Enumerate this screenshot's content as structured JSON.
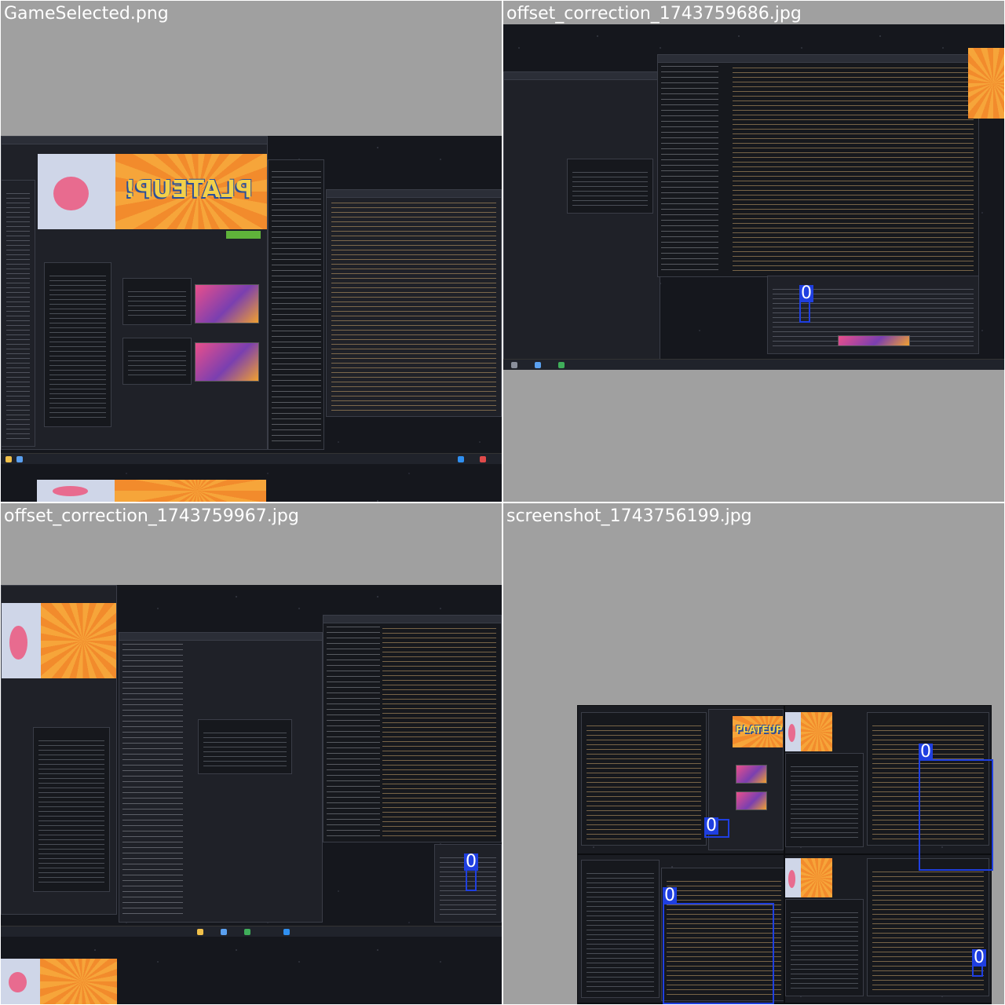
{
  "tiles": [
    {
      "caption": "GameSelected.png",
      "detections": []
    },
    {
      "caption": "offset_correction_1743759686.jpg",
      "detections": [
        {
          "label": "0"
        }
      ]
    },
    {
      "caption": "offset_correction_1743759967.jpg",
      "detections": [
        {
          "label": "0"
        }
      ]
    },
    {
      "caption": "screenshot_1743756199.jpg",
      "detections": [
        {
          "label": "0"
        },
        {
          "label": "0"
        },
        {
          "label": "0"
        },
        {
          "label": "0"
        }
      ]
    }
  ],
  "game_logo": "PLATEUP!",
  "colors": {
    "tile_background": "#a0a0a0",
    "detection_box": "#1f3fe0",
    "desktop": "#15171d",
    "banner_orange": "#f6a53a",
    "logo_yellow": "#f3d04a"
  }
}
